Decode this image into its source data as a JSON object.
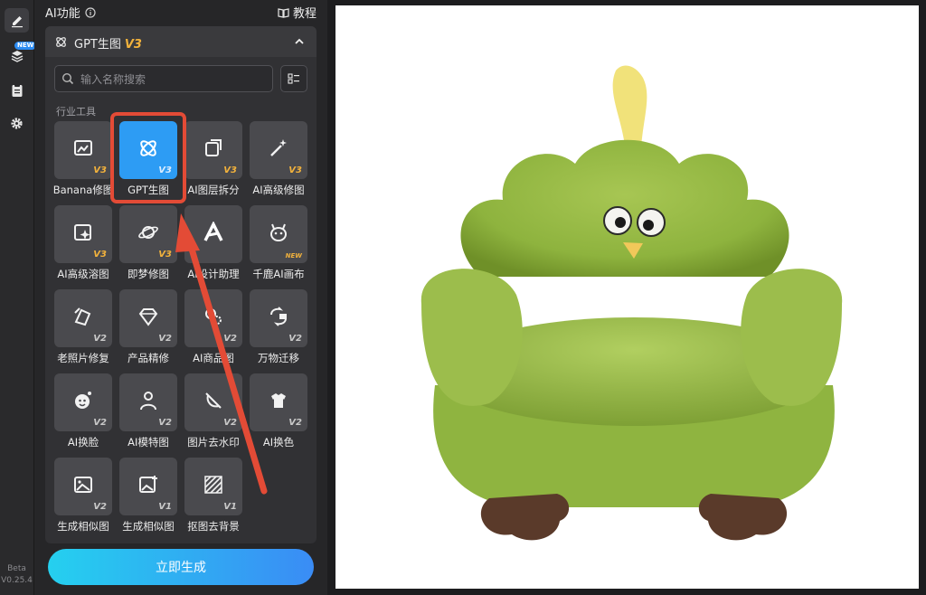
{
  "sidebar": {
    "new_badge": "NEW",
    "beta_label": "Beta",
    "version": "V0.25.4"
  },
  "panel": {
    "title": "AI功能",
    "tutorial_label": "教程",
    "section_title": "GPT生图",
    "section_version": "V3",
    "search_placeholder": "输入名称搜索",
    "category_label": "行业工具",
    "generate_label": "立即生成"
  },
  "tools": [
    {
      "label": "Banana修图",
      "version": "V3",
      "icon": "image-edit-icon"
    },
    {
      "label": "GPT生图",
      "version": "V3",
      "icon": "gpt-logo-icon",
      "selected": true
    },
    {
      "label": "AI图层拆分",
      "version": "V3",
      "icon": "layer-split-icon"
    },
    {
      "label": "AI高级修图",
      "version": "V3",
      "icon": "magic-wand-icon"
    },
    {
      "label": "AI高级溶图",
      "version": "V3",
      "icon": "image-sparkle-icon"
    },
    {
      "label": "即梦修图",
      "version": "V3",
      "icon": "planet-icon"
    },
    {
      "label": "AI设计助理",
      "version": "",
      "icon": "letter-a-icon"
    },
    {
      "label": "千鹿AI画布",
      "version": "NEW",
      "icon": "deer-icon"
    },
    {
      "label": "老照片修复",
      "version": "V2",
      "icon": "photo-restore-icon"
    },
    {
      "label": "产品精修",
      "version": "V2",
      "icon": "diamond-icon"
    },
    {
      "label": "AI商品图",
      "version": "V2",
      "icon": "product-gear-icon"
    },
    {
      "label": "万物迁移",
      "version": "V2",
      "icon": "transfer-icon"
    },
    {
      "label": "AI换脸",
      "version": "V2",
      "icon": "face-swap-icon"
    },
    {
      "label": "AI模特图",
      "version": "V2",
      "icon": "model-icon"
    },
    {
      "label": "图片去水印",
      "version": "V2",
      "icon": "erase-icon"
    },
    {
      "label": "AI换色",
      "version": "V2",
      "icon": "shirt-color-icon"
    },
    {
      "label": "生成相似图",
      "version": "V2",
      "icon": "similar-image-icon"
    },
    {
      "label": "生成相似图",
      "version": "V1",
      "icon": "similar-image-plus-icon"
    },
    {
      "label": "抠图去背景",
      "version": "V1",
      "icon": "remove-bg-icon"
    }
  ],
  "colors": {
    "accent": "#2d9cf4",
    "highlight": "#e34b36",
    "version_gold": "#f2b23c"
  }
}
